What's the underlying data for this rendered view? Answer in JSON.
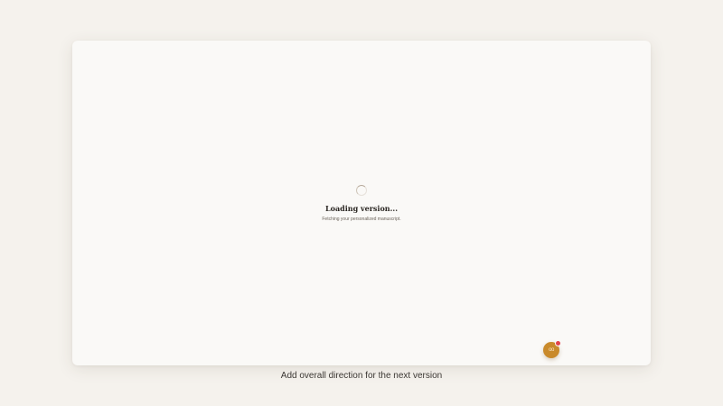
{
  "loading": {
    "title": "Loading version...",
    "subtitle": "Fetching your personalized manuscript."
  },
  "assistant": {
    "icon": "eyes-icon",
    "glyph": "oo",
    "badge_color": "#e2434b",
    "button_color": "#c98a2b"
  },
  "footer": {
    "direction_label": "Add overall direction for the next version"
  },
  "colors": {
    "background": "#f5f2ed",
    "card": "#faf9f7",
    "text": "#2a2622"
  }
}
